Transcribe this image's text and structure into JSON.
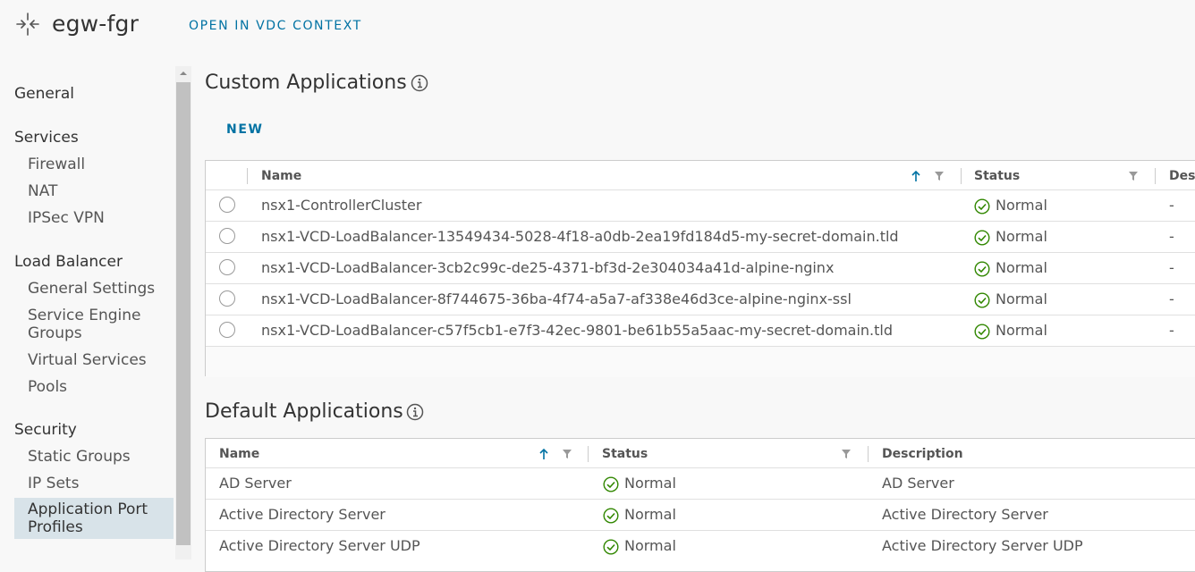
{
  "header": {
    "title": "egw-fgr",
    "open_in_vdc": "OPEN IN VDC CONTEXT"
  },
  "sidebar": {
    "general": "General",
    "services": {
      "label": "Services",
      "items": [
        "Firewall",
        "NAT",
        "IPSec VPN"
      ]
    },
    "load_balancer": {
      "label": "Load Balancer",
      "items": [
        "General Settings",
        "Service Engine Groups",
        "Virtual Services",
        "Pools"
      ]
    },
    "security": {
      "label": "Security",
      "items": [
        "Static Groups",
        "IP Sets",
        "Application Port Profiles"
      ]
    },
    "active_item": "Application Port Profiles"
  },
  "custom_apps": {
    "title": "Custom Applications",
    "new_label": "NEW",
    "columns": {
      "name": "Name",
      "status": "Status",
      "description": "Desc"
    },
    "rows": [
      {
        "name": "nsx1-ControllerCluster",
        "status": "Normal",
        "description": "-"
      },
      {
        "name": "nsx1-VCD-LoadBalancer-13549434-5028-4f18-a0db-2ea19fd184d5-my-secret-domain.tld",
        "status": "Normal",
        "description": "-"
      },
      {
        "name": "nsx1-VCD-LoadBalancer-3cb2c99c-de25-4371-bf3d-2e304034a41d-alpine-nginx",
        "status": "Normal",
        "description": "-"
      },
      {
        "name": "nsx1-VCD-LoadBalancer-8f744675-36ba-4f74-a5a7-af338e46d3ce-alpine-nginx-ssl",
        "status": "Normal",
        "description": "-"
      },
      {
        "name": "nsx1-VCD-LoadBalancer-c57f5cb1-e7f3-42ec-9801-be61b55a5aac-my-secret-domain.tld",
        "status": "Normal",
        "description": "-"
      }
    ]
  },
  "default_apps": {
    "title": "Default Applications",
    "columns": {
      "name": "Name",
      "status": "Status",
      "description": "Description"
    },
    "rows": [
      {
        "name": "AD Server",
        "status": "Normal",
        "description": "AD Server"
      },
      {
        "name": "Active Directory Server",
        "status": "Normal",
        "description": "Active Directory Server"
      },
      {
        "name": "Active Directory Server UDP",
        "status": "Normal",
        "description": "Active Directory Server UDP"
      }
    ]
  },
  "colors": {
    "accent": "#0072a3",
    "success": "#318700",
    "active_nav": "#d8e3e9"
  },
  "icons": {
    "gateway": "edge-gateway-icon",
    "info": "info-circle-icon",
    "status": "check-circle-icon",
    "sort": "arrow-up-icon",
    "filter": "filter-icon"
  }
}
